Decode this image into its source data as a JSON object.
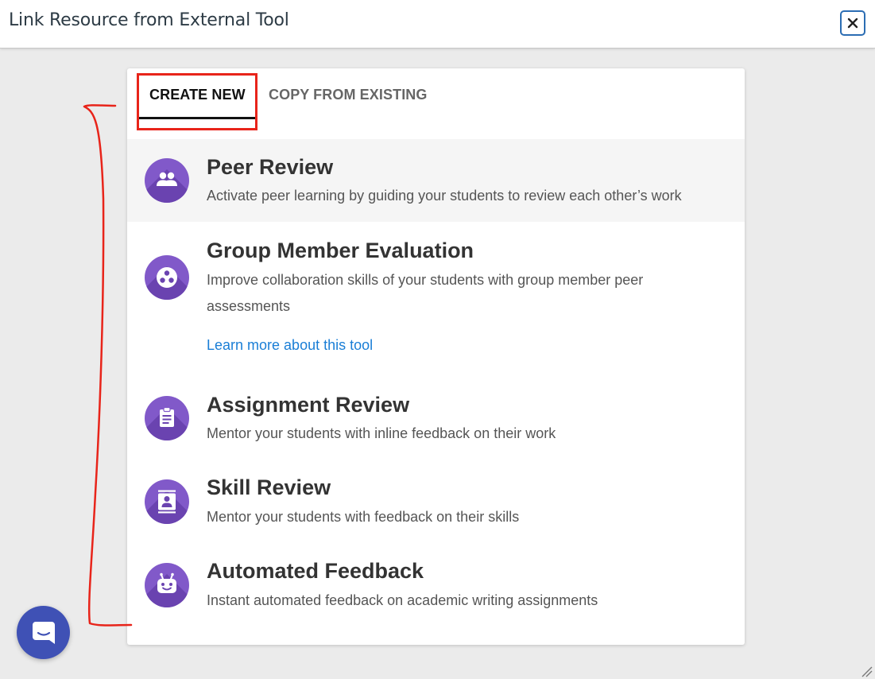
{
  "header": {
    "title": "Link Resource from External Tool",
    "close_icon": "close-icon"
  },
  "tabs": [
    {
      "label": "CREATE NEW",
      "active": true
    },
    {
      "label": "COPY FROM EXISTING",
      "active": false
    }
  ],
  "tools": [
    {
      "title": "Peer Review",
      "description": "Activate peer learning by guiding your students to review each other’s work",
      "icon": "people-icon",
      "hovered": true
    },
    {
      "title": "Group Member Evaluation",
      "description": "Improve collaboration skills of your students with group member peer assessments",
      "link": "Learn more about this tool",
      "icon": "group-dots-icon"
    },
    {
      "title": "Assignment Review",
      "description": "Mentor your students with inline feedback on their work",
      "icon": "clipboard-icon"
    },
    {
      "title": "Skill Review",
      "description": "Mentor your students with feedback on their skills",
      "icon": "contact-card-icon"
    },
    {
      "title": "Automated Feedback",
      "description": "Instant automated feedback on academic writing assignments",
      "icon": "robot-icon"
    }
  ],
  "colors": {
    "tool_icon_bg": "#8159c9",
    "tab_highlight": "#e8241a",
    "link": "#1a7ed6",
    "chat_button": "#3f51b5"
  },
  "chat": {
    "icon": "chat-bubble-icon"
  }
}
